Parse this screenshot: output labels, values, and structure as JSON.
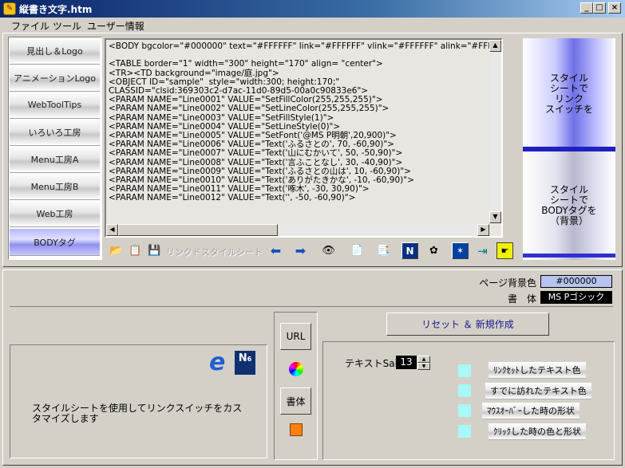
{
  "window": {
    "title": "縦書き文字.htm",
    "minimize": "_",
    "maximize": "□",
    "close": "×"
  },
  "menu": [
    "ファイル",
    "ツール",
    "ユーザー情報"
  ],
  "nav": [
    {
      "label": "見出し＆Logo"
    },
    {
      "label": "アニメーションLogo"
    },
    {
      "label": "WebToolTips"
    },
    {
      "label": "いろいろ工房"
    },
    {
      "label": "Menu工房A"
    },
    {
      "label": "Menu工房B"
    },
    {
      "label": "Web工房"
    },
    {
      "label": "BODYタグ",
      "active": true
    }
  ],
  "code": {
    "lines": [
      "<BODY bgcolor=\"#000000\" text=\"#FFFFFF\" link=\"#FFFFFF\" vlink=\"#FFFFFF\" alink=\"#FFFFFF\">",
      "",
      "<TABLE border=\"1\" width=\"300\" height=\"170\" align= \"center\">",
      "<TR><TD background=\"image/庭.jpg\">",
      "<OBJECT ID=\"sample\"  style=\"width:300; height:170;\"",
      "CLASSID=\"clsid:369303c2-d7ac-11d0-89d5-00a0c90833e6\">",
      "<PARAM NAME=\"Line0001\" VALUE=\"SetFillColor(255,255,255)\">",
      "<PARAM NAME=\"Line0002\" VALUE=\"SetLineColor(255,255,255)\">",
      "<PARAM NAME=\"Line0003\" VALUE=\"SetFillStyle(1)\">",
      "<PARAM NAME=\"Line0004\" VALUE=\"SetLineStyle(0)\">",
      "<PARAM NAME=\"Line0005\" VALUE=\"SetFont('@MS P明朝',20,900)\">",
      "<PARAM NAME=\"Line0006\" VALUE=\"Text('ふるさとの', 70, -60,90)\">",
      "<PARAM NAME=\"Line0007\" VALUE=\"Text('山にむかいて', 50, -50,90)\">",
      "<PARAM NAME=\"Line0008\" VALUE=\"Text('言ふことなし', 30, -40,90)\">",
      "<PARAM NAME=\"Line0009\" VALUE=\"Text('ふるさとの山は', 10, -60,90)\">",
      "<PARAM NAME=\"Line0010\" VALUE=\"Text('ありがたきかな', -10, -60,90)\">",
      "<PARAM NAME=\"Line0011\" VALUE=\"Text('啄木', -30, 30,90)\">",
      "<PARAM NAME=\"Line0012\" VALUE=\"Text('', -50, -60,90)\">"
    ]
  },
  "right_buttons": {
    "style_link_switch": "スタイル\nシートで\nリンク\nスイッチを",
    "style_body_tag": "スタイル\nシートで\nBODYタグを\n（背景）"
  },
  "toolbar": {
    "disabled_label": "リンクドスタイルシート"
  },
  "page": {
    "bg_label": "ページ背景色",
    "bg_value": "#000000",
    "font_label": "書　体",
    "font_value": "MS Pゴシック",
    "reset_button": "リセット ＆ 新規作成"
  },
  "side_buttons": {
    "url": "URL",
    "font": "書体"
  },
  "description": "スタイルシートを使用してリンクスイッチをカスタマイズします",
  "text_size": {
    "label": "テキストSaiz",
    "value": "13"
  },
  "link_options": [
    "ﾘﾝｸｾｯﾄしたテキスト色",
    "すでに訪れたテキスト色",
    "ﾏｳｽｵｰﾊﾞｰした時の形状",
    "ｸﾘｯｸした時の色と形状"
  ],
  "colors": {
    "title_bar": "#0a246a",
    "face": "#d4d0c8",
    "option_square": "#a8f8f8",
    "bg_value_box": "#b8c4f0"
  }
}
